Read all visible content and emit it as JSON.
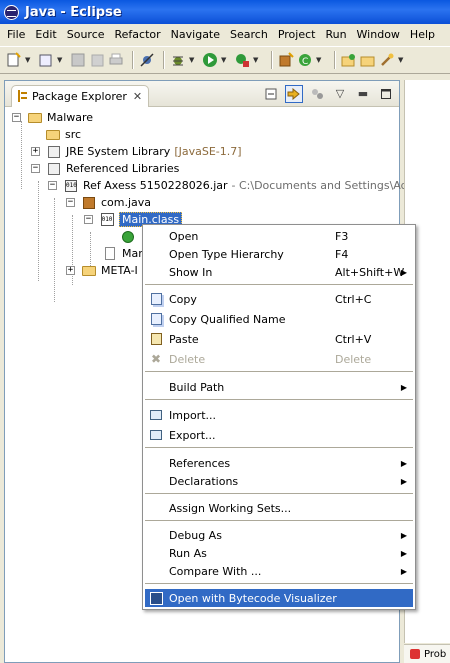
{
  "window": {
    "title": "Java - Eclipse"
  },
  "menubar": [
    "File",
    "Edit",
    "Source",
    "Refactor",
    "Navigate",
    "Search",
    "Project",
    "Run",
    "Window",
    "Help"
  ],
  "view": {
    "tab_label": "Package Explorer"
  },
  "tree": {
    "project": "Malware",
    "src": "src",
    "jre": "JRE System Library",
    "jre_decor": "[JavaSE-1.7]",
    "referenced": "Referenced Libraries",
    "jar": "Ref   Axess  5150228026.jar",
    "jar_decor": "- C:\\Documents and Settings\\Admin",
    "package": "com.java",
    "main_class": "Main.class",
    "manifest_partial": "Mar",
    "meta_inf": "META-I"
  },
  "context_menu": {
    "items": [
      {
        "label": "Open",
        "accel": "F3"
      },
      {
        "label": "Open Type Hierarchy",
        "accel": "F4"
      },
      {
        "label": "Show In",
        "accel": "Alt+Shift+W"
      },
      {
        "label": "Copy",
        "accel": "Ctrl+C"
      },
      {
        "label": "Copy Qualified Name",
        "accel": ""
      },
      {
        "label": "Paste",
        "accel": "Ctrl+V"
      },
      {
        "label": "Delete",
        "accel": "Delete"
      },
      {
        "label": "Build Path",
        "accel": ""
      },
      {
        "label": "Import...",
        "accel": ""
      },
      {
        "label": "Export...",
        "accel": ""
      },
      {
        "label": "References",
        "accel": ""
      },
      {
        "label": "Declarations",
        "accel": ""
      },
      {
        "label": "Assign Working Sets...",
        "accel": ""
      },
      {
        "label": "Debug As",
        "accel": ""
      },
      {
        "label": "Run As",
        "accel": ""
      },
      {
        "label": "Compare With ...",
        "accel": ""
      },
      {
        "label": "Open with Bytecode Visualizer",
        "accel": ""
      }
    ]
  },
  "bottom_tab": {
    "label": "Prob"
  },
  "colors": {
    "selection": "#316ac5",
    "titlebar": "#0a58e0",
    "chrome": "#ece9d8"
  }
}
